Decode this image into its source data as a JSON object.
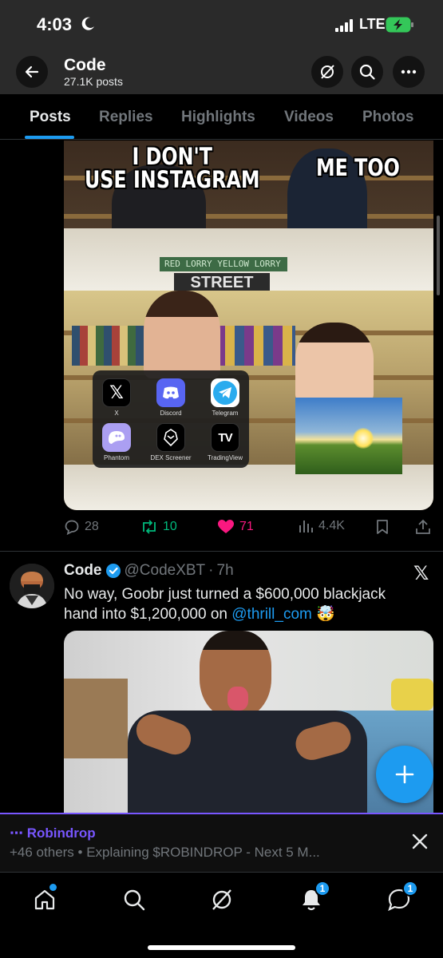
{
  "status_bar": {
    "time": "4:03",
    "network": "LTE"
  },
  "header": {
    "title": "Code",
    "subtitle": "27.1K posts"
  },
  "tabs": [
    {
      "label": "Posts",
      "active": true
    },
    {
      "label": "Replies"
    },
    {
      "label": "Highlights"
    },
    {
      "label": "Videos"
    },
    {
      "label": "Photos"
    }
  ],
  "post1": {
    "image": {
      "caption_left": "I DON'T\nUSE INSTAGRAM",
      "caption_right": "ME TOO",
      "sign_text": "STREET",
      "shelf_text": "RED LORRY YELLOW LORRY",
      "apps": [
        {
          "name": "X",
          "icon": "x-app-icon"
        },
        {
          "name": "Discord",
          "icon": "discord-app-icon"
        },
        {
          "name": "Telegram",
          "icon": "telegram-app-icon"
        },
        {
          "name": "Phantom",
          "icon": "phantom-app-icon"
        },
        {
          "name": "DEX Screener",
          "icon": "dexscreener-app-icon"
        },
        {
          "name": "TradingView",
          "icon": "tradingview-app-icon"
        }
      ]
    },
    "actions": {
      "replies": "28",
      "reposts": "10",
      "likes": "71",
      "views": "4.4K"
    }
  },
  "post2": {
    "name": "Code",
    "handle": "@CodeXBT",
    "time": "7h",
    "text_before": "No way, Goobr just turned a $600,000 blackjack hand into $1,200,000 on ",
    "mention": "@thrill_com",
    "emoji": "🤯"
  },
  "spaces_bar": {
    "title": "Robindrop",
    "subtitle": "+46 others • Explaining $ROBINDROP - Next 5 M..."
  },
  "nav": {
    "notifications_badge": "1",
    "messages_badge": "1"
  },
  "colors": {
    "accent": "#1d9bf0",
    "spaces": "#7856ff",
    "like": "#f91880",
    "repost": "#00ba7c"
  }
}
